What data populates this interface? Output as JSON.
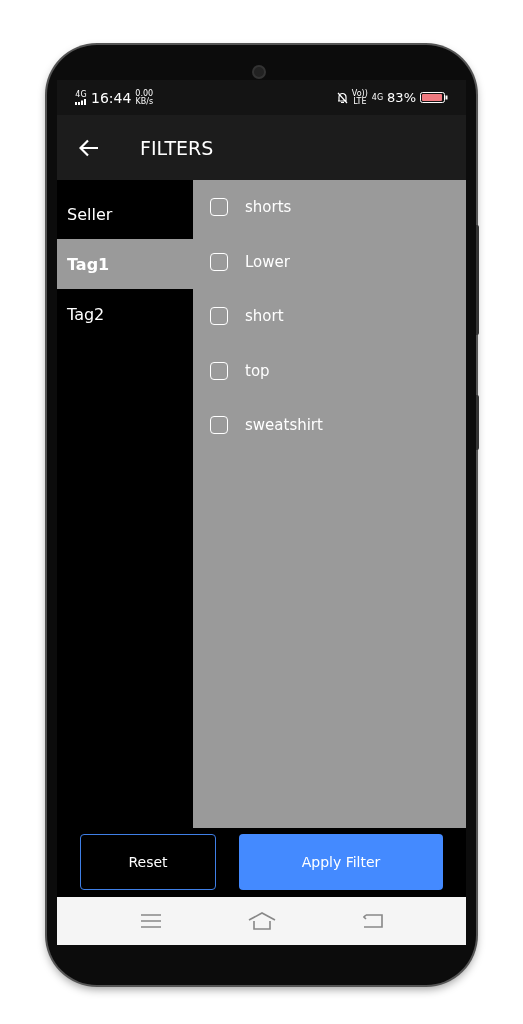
{
  "status_bar": {
    "network": "4G",
    "time": "16:44",
    "speed": "0.00",
    "speed_unit": "KB/s",
    "volte_top": "Vo))",
    "volte_bottom": "LTE",
    "network2": "4G",
    "battery": "83%"
  },
  "app_bar": {
    "title": "FILTERS"
  },
  "categories": [
    {
      "label": "Seller",
      "selected": false
    },
    {
      "label": "Tag1",
      "selected": true
    },
    {
      "label": "Tag2",
      "selected": false
    }
  ],
  "options": [
    {
      "label": "shorts",
      "checked": false
    },
    {
      "label": "Lower",
      "checked": false
    },
    {
      "label": "short",
      "checked": false
    },
    {
      "label": "top",
      "checked": false
    },
    {
      "label": "sweatshirt",
      "checked": false
    }
  ],
  "buttons": [
    {
      "label": "Reset",
      "kind": "outline"
    },
    {
      "label": "Apply Filter",
      "kind": "primary"
    }
  ]
}
